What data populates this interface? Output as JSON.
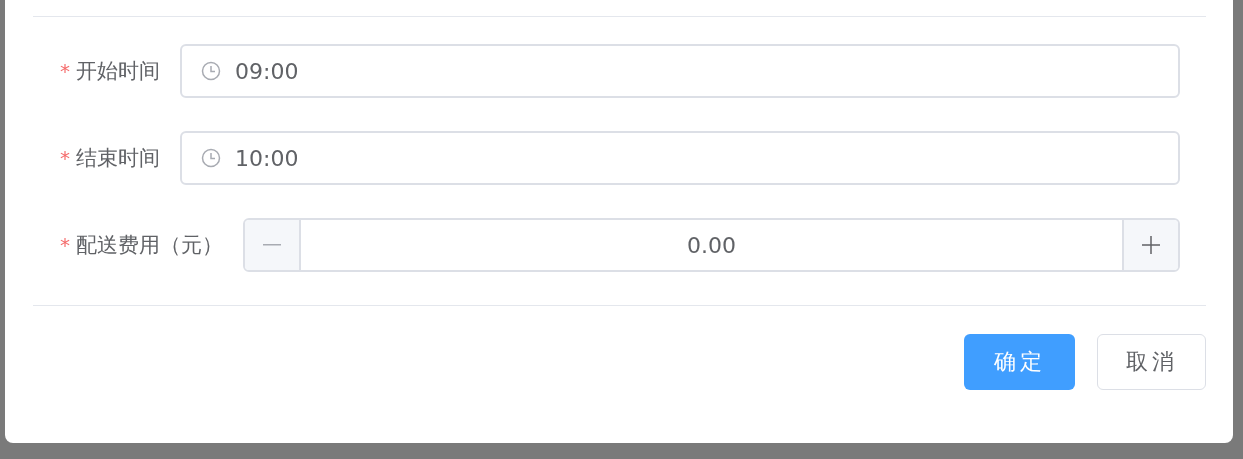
{
  "form": {
    "fields": [
      {
        "kind": "time",
        "required_mark": "*",
        "label": "开始时间",
        "value": "09:00"
      },
      {
        "kind": "time",
        "required_mark": "*",
        "label": "结束时间",
        "value": "10:00"
      },
      {
        "kind": "number",
        "required_mark": "*",
        "label": "配送费用（元）",
        "value": "0.00"
      }
    ]
  },
  "buttons": [
    {
      "label": "确定",
      "primary": true
    },
    {
      "label": "取消",
      "primary": false
    }
  ]
}
